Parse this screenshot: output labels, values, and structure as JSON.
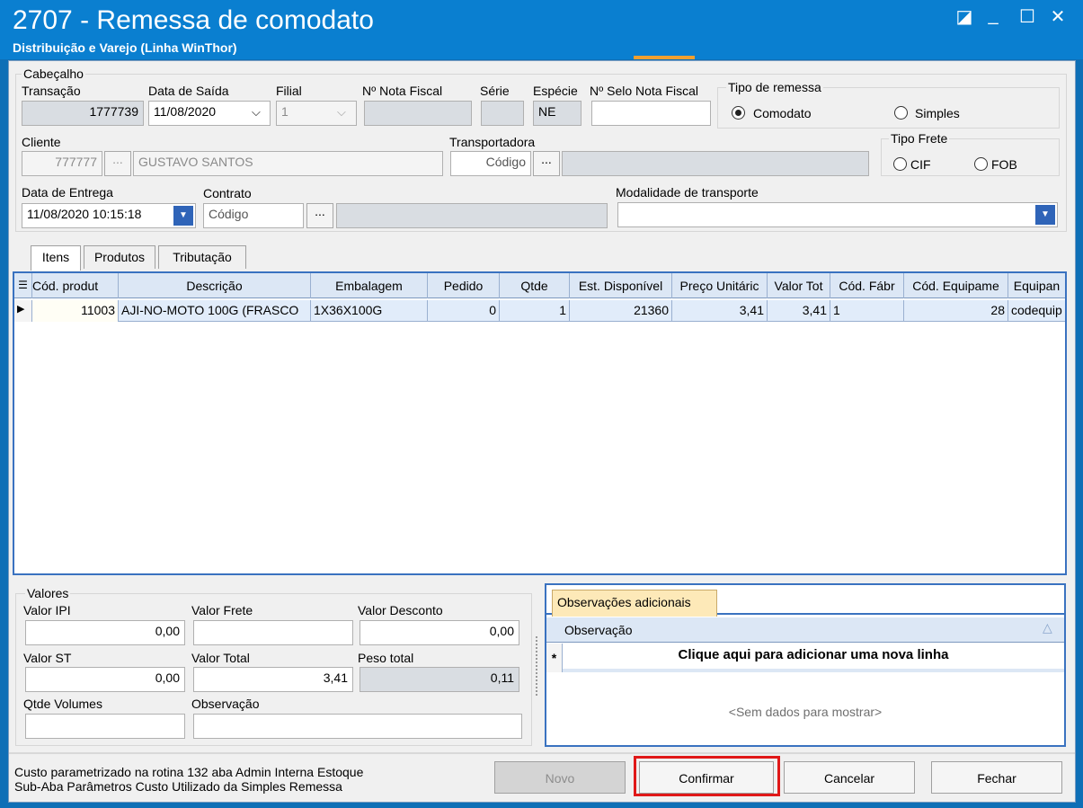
{
  "window": {
    "title": "2707 - Remessa de comodato",
    "subtitle": "Distribuição e Varejo (Linha WinThor)",
    "restore_glyph": "◪",
    "minimize_glyph": "_",
    "maximize_glyph": "☐",
    "close_glyph": "✕"
  },
  "header": {
    "group_label": "Cabeçalho",
    "transacao_label": "Transação",
    "transacao_value": "1777739",
    "data_saida_label": "Data de Saída",
    "data_saida_value": "11/08/2020",
    "filial_label": "Filial",
    "filial_value": "1",
    "nota_fiscal_label": "Nº Nota Fiscal",
    "nota_fiscal_value": "",
    "serie_label": "Série",
    "serie_value": "",
    "especie_label": "Espécie",
    "especie_value": "NE",
    "selo_label": "Nº Selo Nota Fiscal",
    "selo_value": "",
    "cliente_label": "Cliente",
    "cliente_code": "777777",
    "cliente_name": "GUSTAVO SANTOS",
    "transportadora_label": "Transportadora",
    "transportadora_code_placeholder": "Código",
    "data_entrega_label": "Data de Entrega",
    "data_entrega_value": "11/08/2020 10:15:18",
    "contrato_label": "Contrato",
    "contrato_code_placeholder": "Código",
    "modalidade_label": "Modalidade de transporte",
    "modalidade_value": "",
    "ellipsis": "..."
  },
  "tipo_remessa": {
    "label": "Tipo de remessa",
    "option_comodato": "Comodato",
    "option_simples": "Simples",
    "selected": "Comodato"
  },
  "tipo_frete": {
    "label": "Tipo Frete",
    "option_cif": "CIF",
    "option_fob": "FOB"
  },
  "tabs": [
    {
      "label": "Itens",
      "active": true
    },
    {
      "label": "Produtos",
      "active": false
    },
    {
      "label": "Tributação",
      "active": false
    }
  ],
  "grid": {
    "columns": [
      "Cód. produt",
      "Descrição",
      "Embalagem",
      "Pedido",
      "Qtde",
      "Est. Disponível",
      "Preço Unitáric",
      "Valor Tot",
      "Cód. Fábr",
      "Cód. Equipame",
      "Equipan"
    ],
    "rows": [
      [
        "11003",
        "AJI-NO-MOTO 100G (FRASCO",
        "1X36X100G",
        "0",
        "1",
        "21360",
        "3,41",
        "3,41",
        "1",
        "28",
        "codequip"
      ]
    ]
  },
  "valores": {
    "label": "Valores",
    "ipi_label": "Valor IPI",
    "ipi_value": "0,00",
    "frete_label": "Valor Frete",
    "frete_value": "",
    "desconto_label": "Valor Desconto",
    "desconto_value": "0,00",
    "st_label": "Valor ST",
    "st_value": "0,00",
    "total_label": "Valor Total",
    "total_value": "3,41",
    "peso_label": "Peso total",
    "peso_value": "0,11",
    "volumes_label": "Qtde Volumes",
    "volumes_value": "",
    "obs_label": "Observação",
    "obs_value": ""
  },
  "observacoes": {
    "tab_label": "Observações adicionais",
    "column": "Observação",
    "new_row_text": "Clique aqui para adicionar uma nova linha",
    "empty_text": "<Sem dados para mostrar>",
    "new_row_marker": "*"
  },
  "footer": {
    "note_line1": "Custo parametrizado na rotina 132 aba Admin Interna  Estoque",
    "note_line2": "Sub-Aba Parâmetros Custo Utilizado da Simples Remessa",
    "novo": "Novo",
    "confirmar": "Confirmar",
    "cancelar": "Cancelar",
    "fechar": "Fechar"
  }
}
